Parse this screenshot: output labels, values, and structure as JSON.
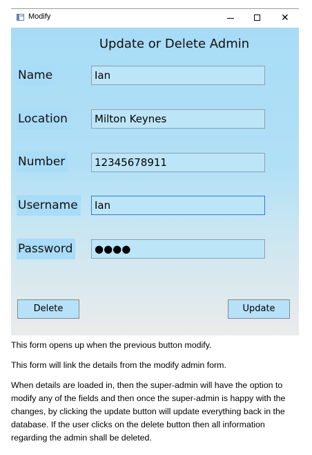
{
  "window": {
    "title": "Modify",
    "controls": {
      "minimize": "—",
      "maximize": "□",
      "close": "✕"
    }
  },
  "form": {
    "heading": "Update or Delete Admin",
    "fields": [
      {
        "label": "Name",
        "value": "Ian"
      },
      {
        "label": "Location",
        "value": "Milton Keynes"
      },
      {
        "label": "Number",
        "value": "12345678911"
      },
      {
        "label": "Username",
        "value": "Ian"
      },
      {
        "label": "Password",
        "value": "●●●●"
      }
    ],
    "buttons": {
      "delete": "Delete",
      "update": "Update"
    }
  },
  "notes": [
    "This form opens up when the previous button modify.",
    "This form will link the details from the modify admin form.",
    "When details are loaded in, then the super-admin will have the option to modify any of the fields and then once the super-admin is happy with the changes, by clicking the update button will update everything back in the database. If the user clicks on the delete button then all information regarding the admin shall be deleted."
  ],
  "colors": {
    "client_top": "#a8dcf6",
    "client_bottom": "#ebebeb",
    "field_bg": "#bde5f8",
    "focus_border": "#2c7ad6"
  },
  "icons": {
    "app": "window-app-icon"
  }
}
